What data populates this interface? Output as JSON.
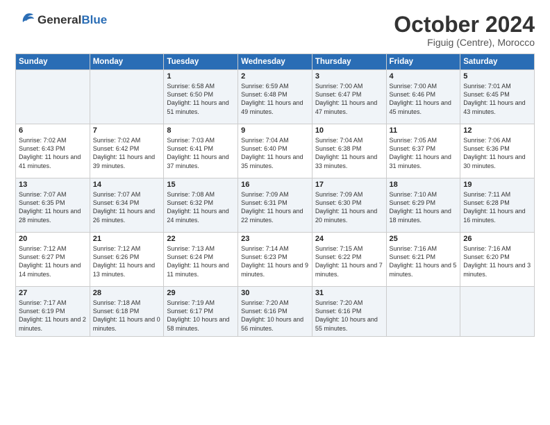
{
  "logo": {
    "general": "General",
    "blue": "Blue"
  },
  "header": {
    "month": "October 2024",
    "location": "Figuig (Centre), Morocco"
  },
  "days_of_week": [
    "Sunday",
    "Monday",
    "Tuesday",
    "Wednesday",
    "Thursday",
    "Friday",
    "Saturday"
  ],
  "weeks": [
    [
      {
        "day": "",
        "sunrise": "",
        "sunset": "",
        "daylight": ""
      },
      {
        "day": "",
        "sunrise": "",
        "sunset": "",
        "daylight": ""
      },
      {
        "day": "1",
        "sunrise": "Sunrise: 6:58 AM",
        "sunset": "Sunset: 6:50 PM",
        "daylight": "Daylight: 11 hours and 51 minutes."
      },
      {
        "day": "2",
        "sunrise": "Sunrise: 6:59 AM",
        "sunset": "Sunset: 6:48 PM",
        "daylight": "Daylight: 11 hours and 49 minutes."
      },
      {
        "day": "3",
        "sunrise": "Sunrise: 7:00 AM",
        "sunset": "Sunset: 6:47 PM",
        "daylight": "Daylight: 11 hours and 47 minutes."
      },
      {
        "day": "4",
        "sunrise": "Sunrise: 7:00 AM",
        "sunset": "Sunset: 6:46 PM",
        "daylight": "Daylight: 11 hours and 45 minutes."
      },
      {
        "day": "5",
        "sunrise": "Sunrise: 7:01 AM",
        "sunset": "Sunset: 6:45 PM",
        "daylight": "Daylight: 11 hours and 43 minutes."
      }
    ],
    [
      {
        "day": "6",
        "sunrise": "Sunrise: 7:02 AM",
        "sunset": "Sunset: 6:43 PM",
        "daylight": "Daylight: 11 hours and 41 minutes."
      },
      {
        "day": "7",
        "sunrise": "Sunrise: 7:02 AM",
        "sunset": "Sunset: 6:42 PM",
        "daylight": "Daylight: 11 hours and 39 minutes."
      },
      {
        "day": "8",
        "sunrise": "Sunrise: 7:03 AM",
        "sunset": "Sunset: 6:41 PM",
        "daylight": "Daylight: 11 hours and 37 minutes."
      },
      {
        "day": "9",
        "sunrise": "Sunrise: 7:04 AM",
        "sunset": "Sunset: 6:40 PM",
        "daylight": "Daylight: 11 hours and 35 minutes."
      },
      {
        "day": "10",
        "sunrise": "Sunrise: 7:04 AM",
        "sunset": "Sunset: 6:38 PM",
        "daylight": "Daylight: 11 hours and 33 minutes."
      },
      {
        "day": "11",
        "sunrise": "Sunrise: 7:05 AM",
        "sunset": "Sunset: 6:37 PM",
        "daylight": "Daylight: 11 hours and 31 minutes."
      },
      {
        "day": "12",
        "sunrise": "Sunrise: 7:06 AM",
        "sunset": "Sunset: 6:36 PM",
        "daylight": "Daylight: 11 hours and 30 minutes."
      }
    ],
    [
      {
        "day": "13",
        "sunrise": "Sunrise: 7:07 AM",
        "sunset": "Sunset: 6:35 PM",
        "daylight": "Daylight: 11 hours and 28 minutes."
      },
      {
        "day": "14",
        "sunrise": "Sunrise: 7:07 AM",
        "sunset": "Sunset: 6:34 PM",
        "daylight": "Daylight: 11 hours and 26 minutes."
      },
      {
        "day": "15",
        "sunrise": "Sunrise: 7:08 AM",
        "sunset": "Sunset: 6:32 PM",
        "daylight": "Daylight: 11 hours and 24 minutes."
      },
      {
        "day": "16",
        "sunrise": "Sunrise: 7:09 AM",
        "sunset": "Sunset: 6:31 PM",
        "daylight": "Daylight: 11 hours and 22 minutes."
      },
      {
        "day": "17",
        "sunrise": "Sunrise: 7:09 AM",
        "sunset": "Sunset: 6:30 PM",
        "daylight": "Daylight: 11 hours and 20 minutes."
      },
      {
        "day": "18",
        "sunrise": "Sunrise: 7:10 AM",
        "sunset": "Sunset: 6:29 PM",
        "daylight": "Daylight: 11 hours and 18 minutes."
      },
      {
        "day": "19",
        "sunrise": "Sunrise: 7:11 AM",
        "sunset": "Sunset: 6:28 PM",
        "daylight": "Daylight: 11 hours and 16 minutes."
      }
    ],
    [
      {
        "day": "20",
        "sunrise": "Sunrise: 7:12 AM",
        "sunset": "Sunset: 6:27 PM",
        "daylight": "Daylight: 11 hours and 14 minutes."
      },
      {
        "day": "21",
        "sunrise": "Sunrise: 7:12 AM",
        "sunset": "Sunset: 6:26 PM",
        "daylight": "Daylight: 11 hours and 13 minutes."
      },
      {
        "day": "22",
        "sunrise": "Sunrise: 7:13 AM",
        "sunset": "Sunset: 6:24 PM",
        "daylight": "Daylight: 11 hours and 11 minutes."
      },
      {
        "day": "23",
        "sunrise": "Sunrise: 7:14 AM",
        "sunset": "Sunset: 6:23 PM",
        "daylight": "Daylight: 11 hours and 9 minutes."
      },
      {
        "day": "24",
        "sunrise": "Sunrise: 7:15 AM",
        "sunset": "Sunset: 6:22 PM",
        "daylight": "Daylight: 11 hours and 7 minutes."
      },
      {
        "day": "25",
        "sunrise": "Sunrise: 7:16 AM",
        "sunset": "Sunset: 6:21 PM",
        "daylight": "Daylight: 11 hours and 5 minutes."
      },
      {
        "day": "26",
        "sunrise": "Sunrise: 7:16 AM",
        "sunset": "Sunset: 6:20 PM",
        "daylight": "Daylight: 11 hours and 3 minutes."
      }
    ],
    [
      {
        "day": "27",
        "sunrise": "Sunrise: 7:17 AM",
        "sunset": "Sunset: 6:19 PM",
        "daylight": "Daylight: 11 hours and 2 minutes."
      },
      {
        "day": "28",
        "sunrise": "Sunrise: 7:18 AM",
        "sunset": "Sunset: 6:18 PM",
        "daylight": "Daylight: 11 hours and 0 minutes."
      },
      {
        "day": "29",
        "sunrise": "Sunrise: 7:19 AM",
        "sunset": "Sunset: 6:17 PM",
        "daylight": "Daylight: 10 hours and 58 minutes."
      },
      {
        "day": "30",
        "sunrise": "Sunrise: 7:20 AM",
        "sunset": "Sunset: 6:16 PM",
        "daylight": "Daylight: 10 hours and 56 minutes."
      },
      {
        "day": "31",
        "sunrise": "Sunrise: 7:20 AM",
        "sunset": "Sunset: 6:16 PM",
        "daylight": "Daylight: 10 hours and 55 minutes."
      },
      {
        "day": "",
        "sunrise": "",
        "sunset": "",
        "daylight": ""
      },
      {
        "day": "",
        "sunrise": "",
        "sunset": "",
        "daylight": ""
      }
    ]
  ]
}
